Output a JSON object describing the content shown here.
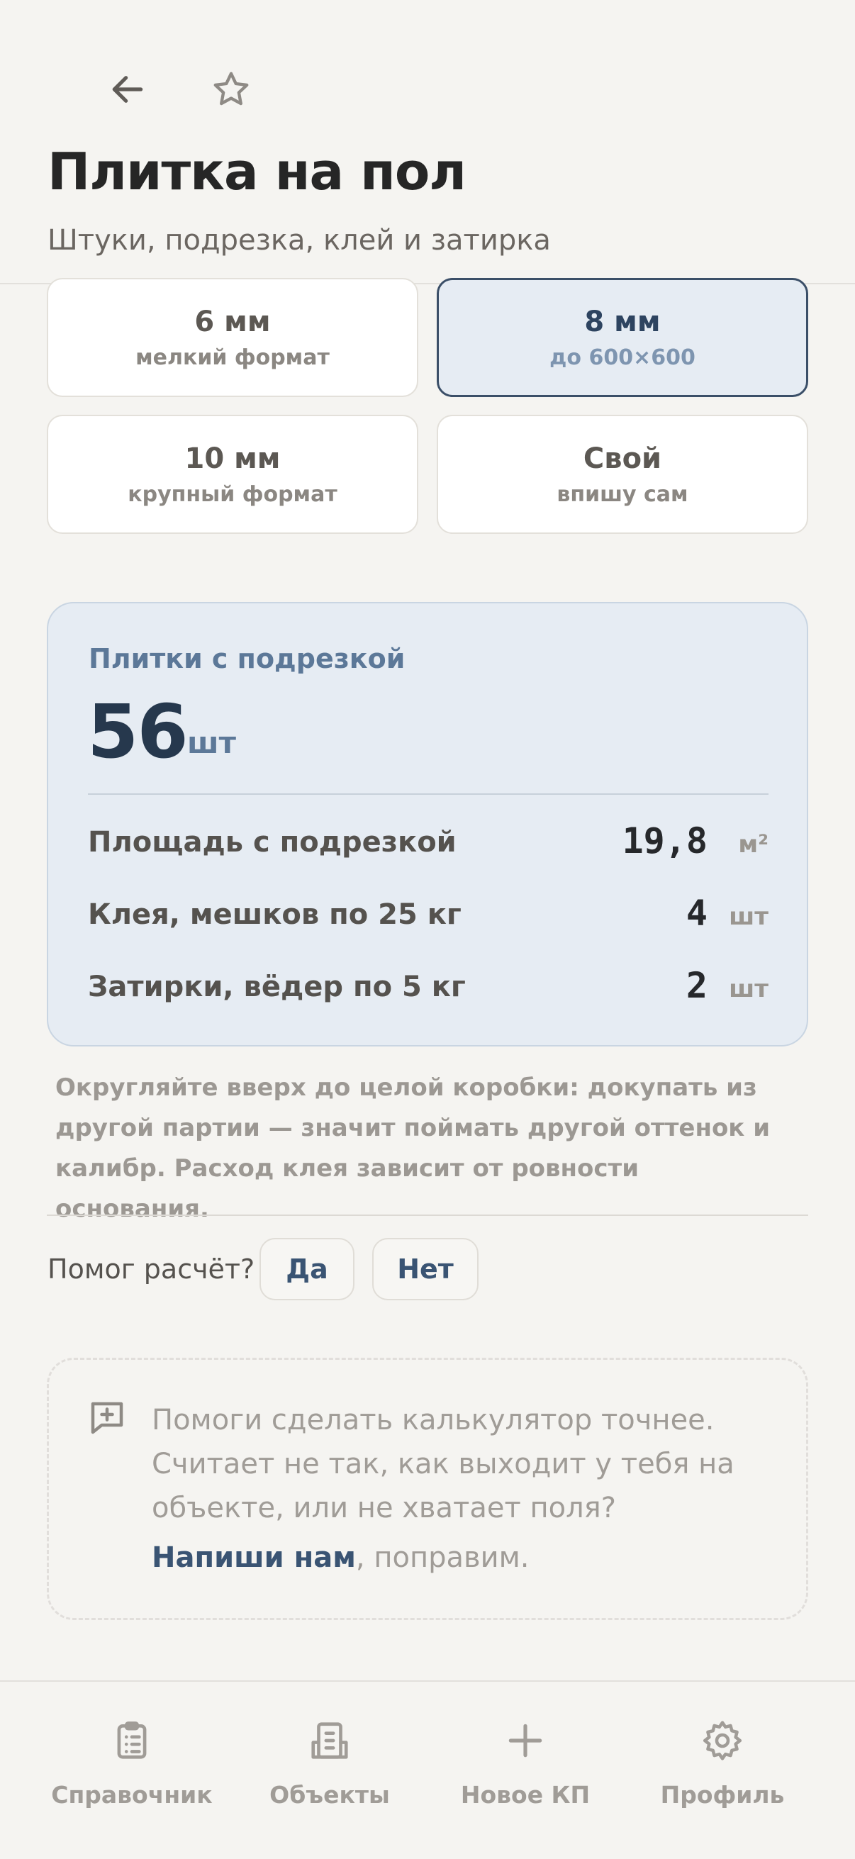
{
  "header": {
    "back_icon": "arrow-left-icon",
    "favorite_icon": "star-icon",
    "title": "Плитка на пол",
    "subtitle": "Штуки, подрезка, клей и затирка"
  },
  "joint_options": [
    {
      "value": "6 мм",
      "caption": "мелкий формат",
      "selected": false
    },
    {
      "value": "8 мм",
      "caption": "до 600×600",
      "selected": true
    },
    {
      "value": "10 мм",
      "caption": "крупный формат",
      "selected": false
    },
    {
      "value": "Свой",
      "caption": "впишу сам",
      "selected": false
    }
  ],
  "result": {
    "label": "Плитки с подрезкой",
    "count": "56",
    "count_unit": "шт",
    "rows": [
      {
        "label": "Площадь с подрезкой",
        "value": "19,8",
        "unit": "м²"
      },
      {
        "label": "Клея, мешков по 25 кг",
        "value": "4",
        "unit": "шт"
      },
      {
        "label": "Затирки, вёдер по 5 кг",
        "value": "2",
        "unit": "шт"
      }
    ]
  },
  "note": "Округляйте вверх до целой коробки: докупать из другой партии — значит поймать другой оттенок и калибр. Расход клея зависит от ровности основания.",
  "feedback": {
    "question": "Помог расчёт?",
    "yes": "Да",
    "no": "Нет",
    "box_icon": "message-plus-icon",
    "box_text": "Помоги сделать калькулятор точнее. Считает не так, как выходит у тебя на объекте, или не хватает поля?",
    "link": "Напиши нам",
    "link_suffix": ", поправим."
  },
  "nav": [
    {
      "label": "Справочник",
      "icon": "clipboard-list-icon"
    },
    {
      "label": "Объекты",
      "icon": "building-icon"
    },
    {
      "label": "Новое КП",
      "icon": "plus-icon"
    },
    {
      "label": "Профиль",
      "icon": "gear-icon"
    }
  ],
  "colors": {
    "background": "#f5f4f1",
    "accent": "#3a5473",
    "selected_tile": "#e6ecf3",
    "result_card": "#e6ecf3"
  }
}
